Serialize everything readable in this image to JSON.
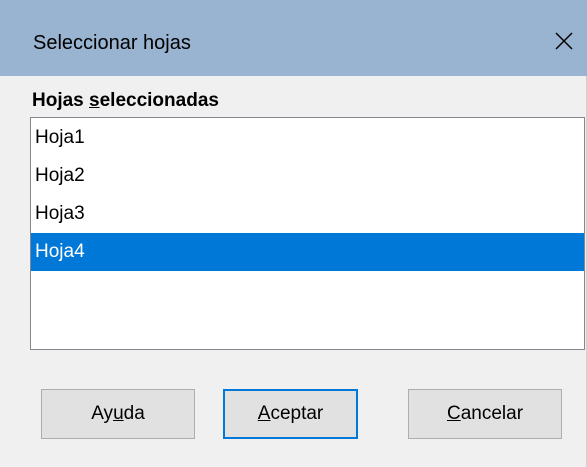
{
  "window": {
    "title": "Seleccionar hojas",
    "close_icon": "close-icon"
  },
  "list": {
    "label_pre": "Hojas ",
    "label_mnemonic": "s",
    "label_post": "eleccionadas",
    "items": [
      "Hoja1",
      "Hoja2",
      "Hoja3",
      "Hoja4"
    ],
    "selected": "Hoja4"
  },
  "buttons": {
    "help": {
      "pre": "Ay",
      "mnemonic": "u",
      "post": "da"
    },
    "ok": {
      "pre": "",
      "mnemonic": "A",
      "post": "ceptar"
    },
    "cancel": {
      "pre": "",
      "mnemonic": "C",
      "post": "ancelar"
    }
  },
  "colors": {
    "titlebar": "#99b4d1",
    "selection": "#0078d7",
    "dialog_bg": "#f0f0f0"
  }
}
